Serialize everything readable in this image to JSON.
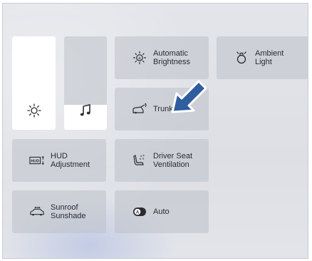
{
  "sliders": [
    {
      "name": "brightness",
      "icon": "sun-icon",
      "level": 1.0
    },
    {
      "name": "volume",
      "icon": "music-note-icon",
      "level": 0.27
    }
  ],
  "tiles": {
    "automatic_brightness": {
      "label": "Automatic\nBrightness",
      "icon": "auto-brightness-icon"
    },
    "ambient_light": {
      "label": "Ambient\nLight",
      "icon": "ambient-light-icon"
    },
    "trunk": {
      "label": "Trunk",
      "icon": "trunk-icon"
    },
    "hud_adjustment": {
      "label": "HUD\nAdjustment",
      "icon": "hud-icon"
    },
    "driver_seat_ventilation": {
      "label": "Driver Seat\nVentilation",
      "icon": "seat-ventilation-icon"
    },
    "sunroof_sunshade": {
      "label": "Sunroof\nSunshade",
      "icon": "sunroof-icon"
    },
    "auto": {
      "label": "Auto",
      "icon": "auto-toggle-icon"
    }
  },
  "pointer": {
    "icon": "arrow-pointer-icon",
    "color": "#2f5d9e"
  }
}
